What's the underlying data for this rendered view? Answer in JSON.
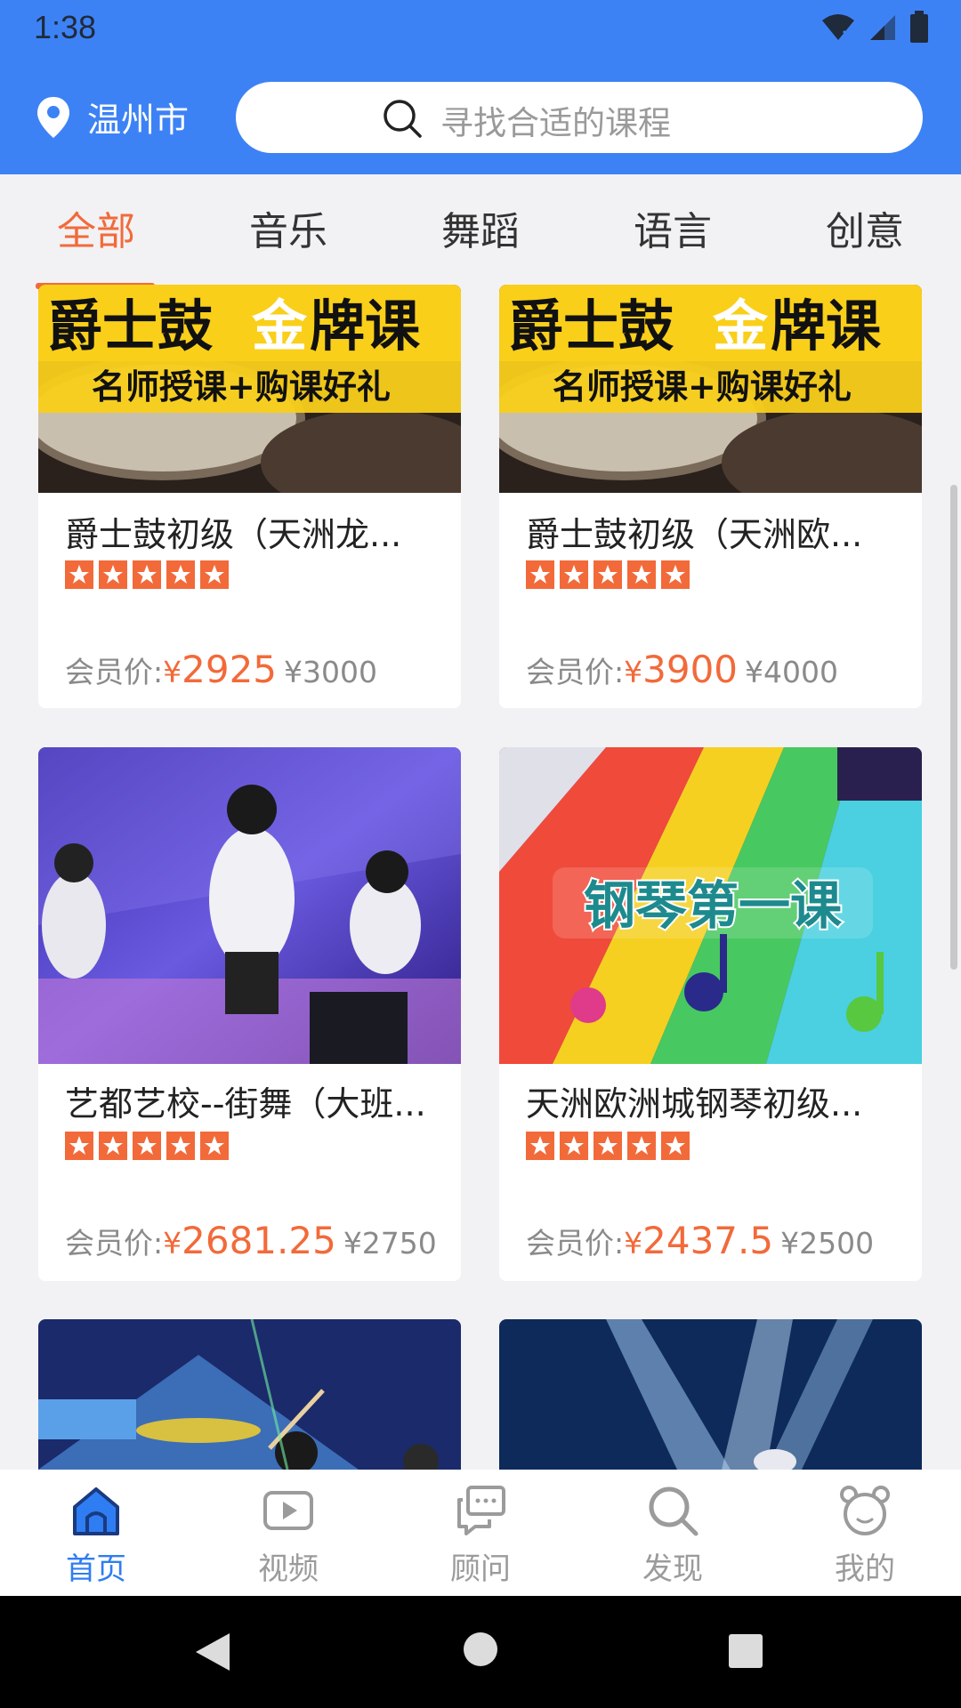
{
  "status_bar": {
    "time": "1:38"
  },
  "header": {
    "city": "温州市",
    "search_placeholder": "寻找合适的课程"
  },
  "tabs": [
    {
      "label": "全部",
      "active": true
    },
    {
      "label": "音乐",
      "active": false
    },
    {
      "label": "舞蹈",
      "active": false
    },
    {
      "label": "语言",
      "active": false
    },
    {
      "label": "创意",
      "active": false
    }
  ],
  "courses": [
    {
      "title": "爵士鼓初级（天洲龙...",
      "price_label": "会员价:",
      "currency": "¥",
      "price": "2925",
      "original": "¥3000",
      "banner": {
        "headline_a": "爵士鼓",
        "headline_b": "金",
        "headline_c": "牌课",
        "sub": "名师授课+购课好礼"
      }
    },
    {
      "title": "爵士鼓初级（天洲欧...",
      "price_label": "会员价:",
      "currency": "¥",
      "price": "3900",
      "original": "¥4000",
      "banner": {
        "headline_a": "爵士鼓",
        "headline_b": "金",
        "headline_c": "牌课",
        "sub": "名师授课+购课好礼"
      }
    },
    {
      "title": "艺都艺校--街舞（大班...",
      "price_label": "会员价:",
      "currency": "¥",
      "price": "2681.25",
      "original": "¥2750"
    },
    {
      "title": "天洲欧洲城钢琴初级...",
      "price_label": "会员价:",
      "currency": "¥",
      "price": "2437.5",
      "original": "¥2500",
      "banner": {
        "headline": "钢琴第一课"
      }
    }
  ],
  "bottom_nav": [
    {
      "label": "首页",
      "icon": "home-icon",
      "active": true
    },
    {
      "label": "视频",
      "icon": "video-icon",
      "active": false
    },
    {
      "label": "顾问",
      "icon": "chat-icon",
      "active": false
    },
    {
      "label": "发现",
      "icon": "search-icon",
      "active": false
    },
    {
      "label": "我的",
      "icon": "bear-icon",
      "active": false
    }
  ],
  "colors": {
    "primary": "#3d82f5",
    "accent": "#f26a3a",
    "nav_active": "#2f7df2"
  }
}
